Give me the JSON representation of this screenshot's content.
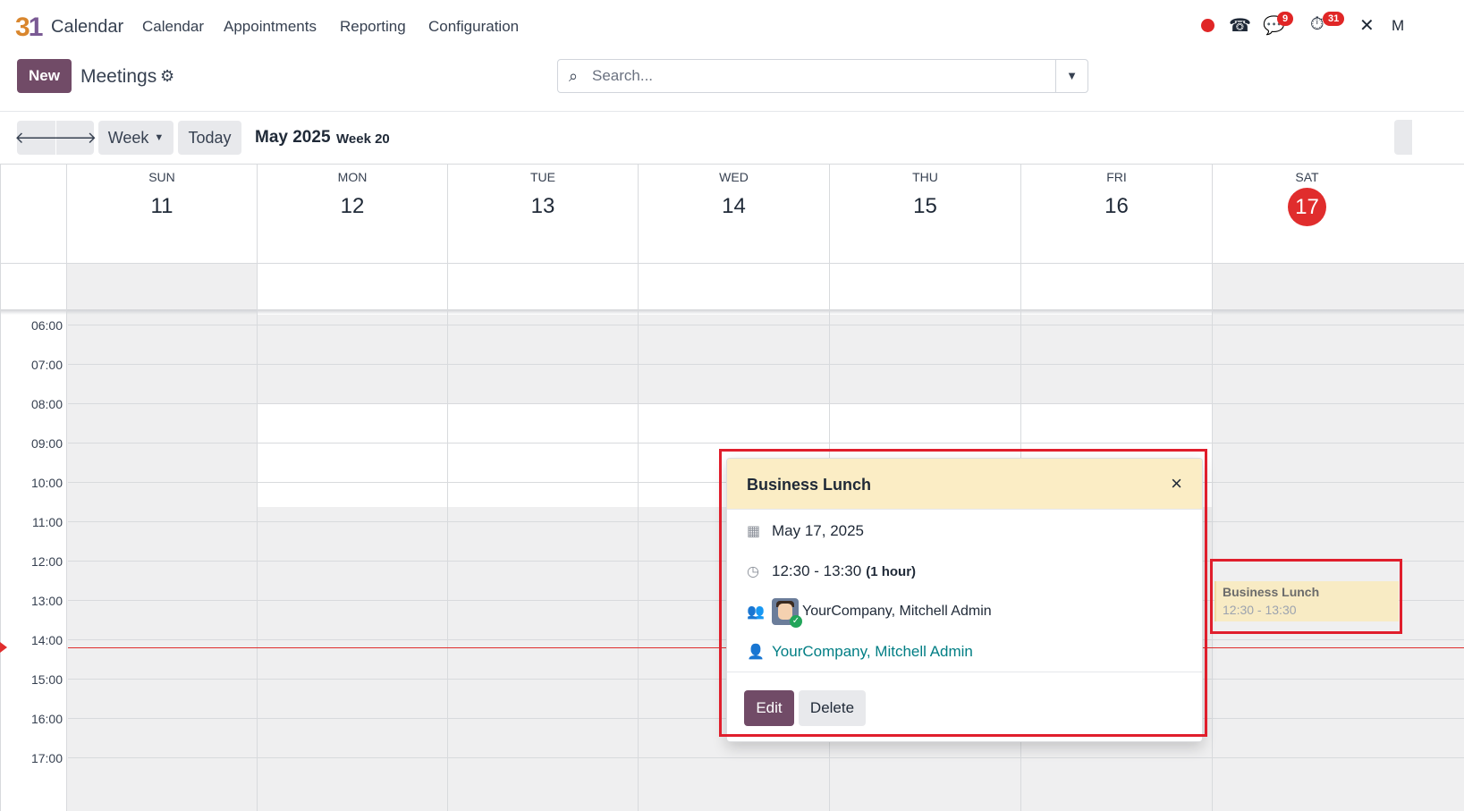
{
  "app": {
    "logo_digit_a": "3",
    "logo_digit_b": "1",
    "name": "Calendar"
  },
  "menu": [
    "Calendar",
    "Appointments",
    "Reporting",
    "Configuration"
  ],
  "systray": {
    "chat_count": "9",
    "activity_count": "31",
    "user_initial": "M"
  },
  "toolbar": {
    "new_label": "New",
    "title": "Meetings"
  },
  "search": {
    "placeholder": "Search..."
  },
  "calendar_nav": {
    "scale_label": "Week",
    "today_label": "Today",
    "period": "May 2025",
    "week": "Week 20"
  },
  "days": [
    {
      "name": "SUN",
      "num": "11"
    },
    {
      "name": "MON",
      "num": "12"
    },
    {
      "name": "TUE",
      "num": "13"
    },
    {
      "name": "WED",
      "num": "14"
    },
    {
      "name": "THU",
      "num": "15"
    },
    {
      "name": "FRI",
      "num": "16"
    },
    {
      "name": "SAT",
      "num": "17"
    }
  ],
  "hours": [
    "06:00",
    "07:00",
    "08:00",
    "09:00",
    "10:00",
    "11:00",
    "12:00",
    "13:00",
    "14:00",
    "15:00",
    "16:00",
    "17:00"
  ],
  "event": {
    "title": "Business Lunch",
    "time": "12:30 - 13:30"
  },
  "popover": {
    "title": "Business Lunch",
    "date": "May 17, 2025",
    "time": "12:30 - 13:30",
    "duration": "(1 hour)",
    "attendees": "YourCompany, Mitchell Admin",
    "organizer": "YourCompany, Mitchell Admin",
    "edit_label": "Edit",
    "delete_label": "Delete"
  },
  "colors": {
    "brand": "#714b67",
    "today": "#e02d2d",
    "event_bg": "#f8ebc4",
    "highlight": "#e01e2c"
  }
}
